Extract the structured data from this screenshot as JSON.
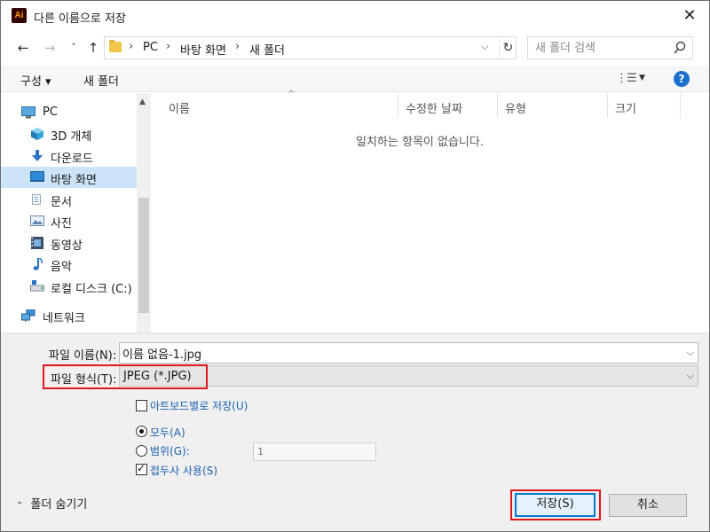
{
  "window": {
    "app_icon_text": "Ai",
    "title": "다른 이름으로 저장",
    "close_label": "✕"
  },
  "navigation": {
    "back": "←",
    "forward": "→",
    "recent": "˅",
    "up": "↑"
  },
  "address_bar": {
    "crumbs": [
      "PC",
      "바탕 화면",
      "새 폴더"
    ],
    "separator": "›",
    "dropdown": "⌵",
    "refresh": "↻"
  },
  "search": {
    "placeholder": "새 폴더 검색"
  },
  "toolbar": {
    "organize_label": "구성 ▾",
    "new_folder_label": "새 폴더",
    "view_icon": "⋮☰",
    "view_dropdown": "▼",
    "help_label": "?"
  },
  "nav_pane": {
    "items": [
      {
        "label": "PC",
        "icon": "pc-icon"
      },
      {
        "label": "3D 개체",
        "icon": "3d-objects-icon"
      },
      {
        "label": "다운로드",
        "icon": "download-icon"
      },
      {
        "label": "바탕 화면",
        "icon": "desktop-icon",
        "selected": true
      },
      {
        "label": "문서",
        "icon": "documents-icon"
      },
      {
        "label": "사진",
        "icon": "pictures-icon"
      },
      {
        "label": "동영상",
        "icon": "videos-icon"
      },
      {
        "label": "음악",
        "icon": "music-icon"
      },
      {
        "label": "로컬 디스크 (C:)",
        "icon": "local-disk-icon"
      },
      {
        "label": "네트워크",
        "icon": "network-icon"
      }
    ],
    "scroll_up": "▲"
  },
  "file_list": {
    "columns": [
      "이름",
      "수정한 날짜",
      "유형",
      "크기"
    ],
    "sort_indicator": "^",
    "empty_message": "일치하는 항목이 없습니다."
  },
  "save_options": {
    "filename_label": "파일 이름(N):",
    "filename_value": "이름 없음-1.jpg",
    "filetype_label": "파일 형식(T):",
    "filetype_value": "JPEG (*.JPG)",
    "chevron": "⌵",
    "artboards_label": "아트보드별로 저장(U)",
    "artboards_checked": false,
    "all_label": "모두(A)",
    "range_label": "범위(G):",
    "range_value": "1",
    "selected_option": "all",
    "bleed_label": "접두사 사용(S)",
    "bleed_checked": true
  },
  "footer": {
    "hide_folders_caret": "⌃",
    "hide_folders_label": "폴더 숨기기",
    "save_label": "저장(S)",
    "cancel_label": "취소"
  },
  "colors": {
    "highlight_red": "#e0161d",
    "selection_blue": "#cce4f7",
    "default_button_border": "#0078d7",
    "help_blue": "#1a6fcc"
  }
}
